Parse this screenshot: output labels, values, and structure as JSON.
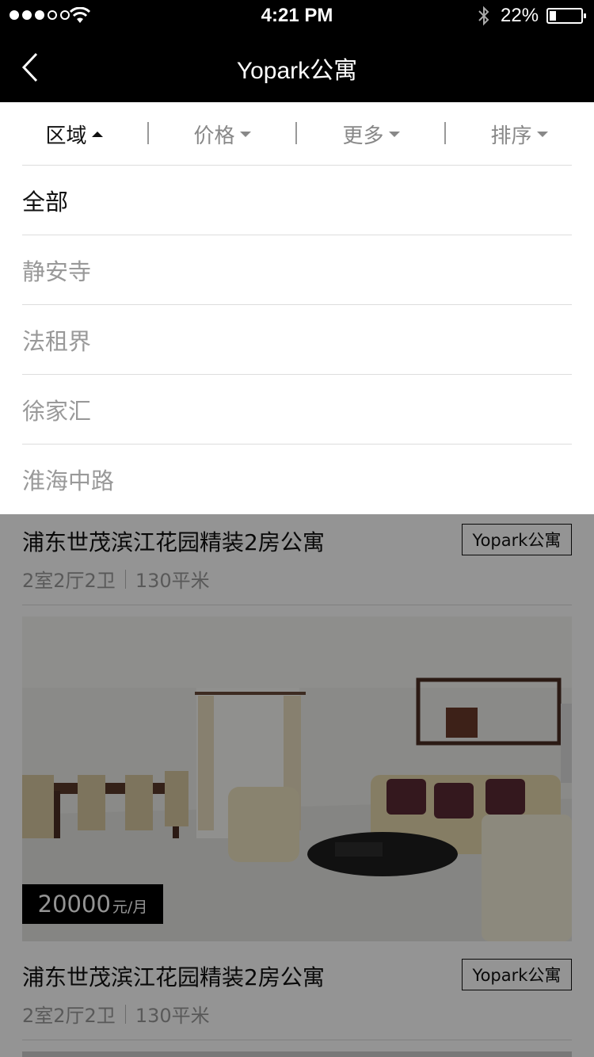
{
  "status_bar": {
    "time": "4:21 PM",
    "battery_percent": "22%",
    "battery_level": 0.22
  },
  "nav": {
    "title": "Yopark公寓",
    "back_icon": "chevron-left-icon"
  },
  "filters": [
    {
      "label": "区域",
      "active": true
    },
    {
      "label": "价格",
      "active": false
    },
    {
      "label": "更多",
      "active": false
    },
    {
      "label": "排序",
      "active": false
    }
  ],
  "region_options": [
    {
      "label": "全部",
      "selected": true
    },
    {
      "label": "静安寺",
      "selected": false
    },
    {
      "label": "法租界",
      "selected": false
    },
    {
      "label": "徐家汇",
      "selected": false
    },
    {
      "label": "淮海中路",
      "selected": false
    }
  ],
  "listings": [
    {
      "title": "浦东世茂滨江花园精装2房公寓",
      "tag": "Yopark公寓",
      "layout": "2室2厅2卫",
      "area": "130平米",
      "price": "20000",
      "price_unit": "元/月"
    },
    {
      "title": "浦东世茂滨江花园精装2房公寓",
      "tag": "Yopark公寓",
      "layout": "2室2厅2卫",
      "area": "130平米"
    }
  ],
  "colors": {
    "nav_bg": "#000000",
    "overlay": "rgba(0,0,0,0.42)",
    "inactive_text": "#888888"
  }
}
